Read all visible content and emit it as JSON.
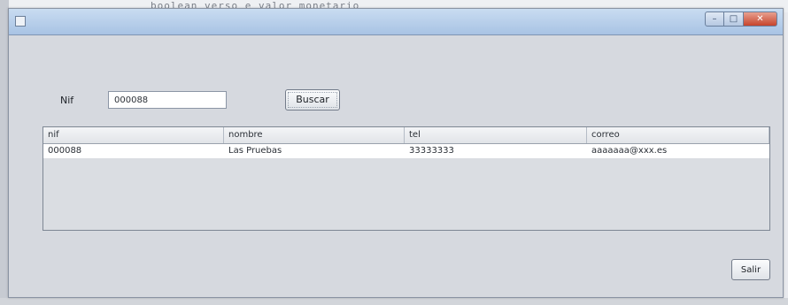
{
  "background": {
    "editor_text": "boolean verso e valor monetario"
  },
  "window": {
    "title": "",
    "controls": {
      "minimize": "–",
      "maximize": "□",
      "close": "✕"
    }
  },
  "form": {
    "nif_label": "Nif",
    "nif_value": "000088",
    "search_button": "Buscar"
  },
  "table": {
    "columns": [
      "nif",
      "nombre",
      "tel",
      "correo"
    ],
    "rows": [
      [
        "000088",
        "Las Pruebas",
        "33333333",
        "aaaaaaa@xxx.es"
      ]
    ]
  },
  "footer": {
    "exit_button": "Salir"
  },
  "colors": {
    "window_bg": "#d6d9df",
    "titlebar": "#b8cfea",
    "close_button": "#c6442c"
  }
}
